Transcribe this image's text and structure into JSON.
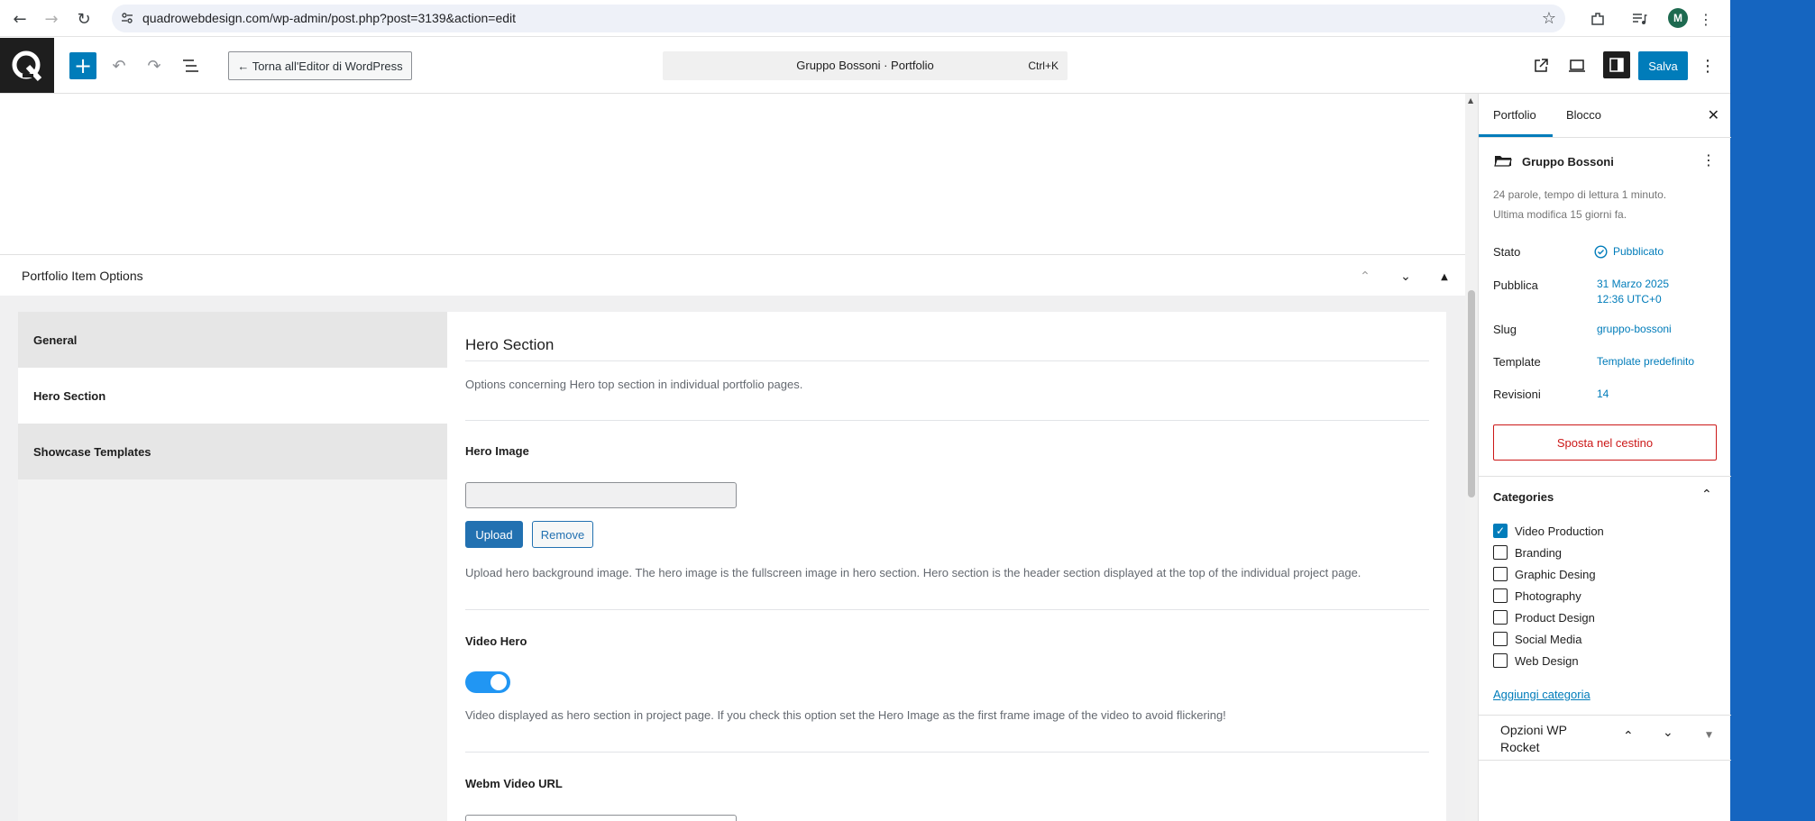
{
  "browser": {
    "url": "quadrowebdesign.com/wp-admin/post.php?post=3139&action=edit",
    "profile_initial": "M"
  },
  "editor_header": {
    "back_label": "← Torna all'Editor di WordPress",
    "command_title": "Gruppo Bossoni · Portfolio",
    "command_shortcut": "Ctrl+K",
    "save_label": "Salva"
  },
  "metabox": {
    "title": "Portfolio Item Options",
    "tabs": [
      {
        "label": "General",
        "active": false
      },
      {
        "label": "Hero Section",
        "active": true
      },
      {
        "label": "Showcase Templates",
        "active": false
      }
    ],
    "panel": {
      "title": "Hero Section",
      "description": "Options concerning Hero top section in individual portfolio pages.",
      "hero_image_label": "Hero Image",
      "hero_image_value": "",
      "upload_label": "Upload",
      "remove_label": "Remove",
      "hero_image_help": "Upload hero background image. The hero image is the fullscreen image in hero section. Hero section is the header section displayed at the top of the individual project page.",
      "video_hero_label": "Video Hero",
      "video_hero_enabled": true,
      "video_hero_help": "Video displayed as hero section in project page. If you check this option set the Hero Image as the first frame image of the video to avoid flickering!",
      "webm_label": "Webm Video URL"
    }
  },
  "sidebar": {
    "tabs": [
      "Portfolio",
      "Blocco"
    ],
    "post_title": "Gruppo Bossoni",
    "meta_line1": "24 parole, tempo di lettura 1 minuto.",
    "meta_line2": "Ultima modifica 15 giorni fa.",
    "rows": {
      "stato_label": "Stato",
      "stato_value": "Pubblicato",
      "pubblica_label": "Pubblica",
      "pubblica_date": "31 Marzo 2025",
      "pubblica_time": "12:36 UTC+0",
      "slug_label": "Slug",
      "slug_value": "gruppo-bossoni",
      "template_label": "Template",
      "template_value": "Template predefinito",
      "revisioni_label": "Revisioni",
      "revisioni_value": "14"
    },
    "trash_label": "Sposta nel cestino",
    "categories_title": "Categories",
    "categories": [
      {
        "label": "Video Production",
        "checked": true
      },
      {
        "label": "Branding",
        "checked": false
      },
      {
        "label": "Graphic Desing",
        "checked": false
      },
      {
        "label": "Photography",
        "checked": false
      },
      {
        "label": "Product Design",
        "checked": false
      },
      {
        "label": "Social Media",
        "checked": false
      },
      {
        "label": "Web Design",
        "checked": false
      }
    ],
    "add_category": "Aggiungi categoria",
    "wprocket_title": "Opzioni WP Rocket"
  },
  "colors": {
    "accent": "#007cba",
    "toggle_on": "#2196f3",
    "danger": "#cc1818",
    "side_strip": "#1565c0"
  }
}
